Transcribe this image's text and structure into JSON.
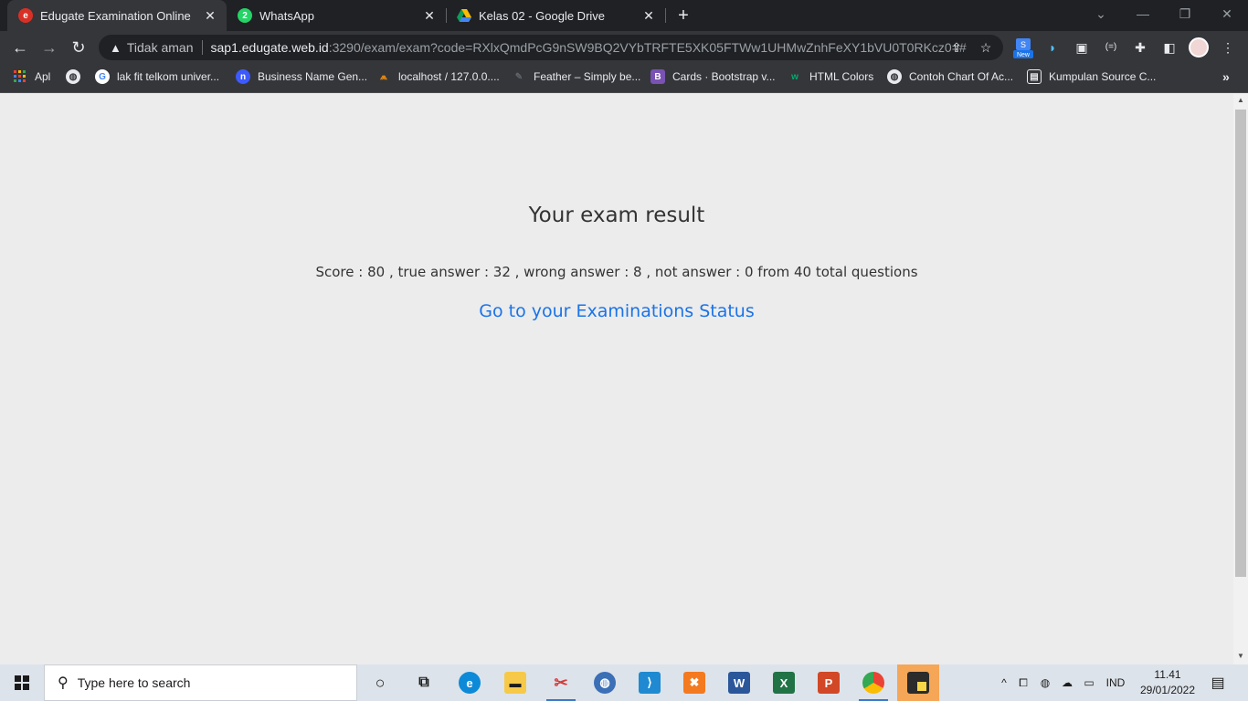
{
  "browser": {
    "tabs": [
      {
        "title": "Edugate Examination Online",
        "active": true,
        "icon": "edugate-icon"
      },
      {
        "title": "WhatsApp",
        "active": false,
        "icon": "whatsapp-icon"
      },
      {
        "title": "Kelas 02 - Google Drive",
        "active": false,
        "icon": "google-drive-icon"
      }
    ],
    "new_tab_glyph": "+",
    "window_controls": {
      "minimize": "—",
      "restore": "❐",
      "close": "✕"
    },
    "security_label": "Tidak aman",
    "url_host": "sap1.edugate.web.id",
    "url_rest": ":3290/exam/exam?code=RXlxQmdPcG9nSW9BQ2VYbTRFTE5XK05FTWw1UHMwZnhFeXY1bVU0T0RKcz0=#",
    "extension_badge": "New"
  },
  "bookmarks": [
    {
      "label": "Apl",
      "icon": "apps-grid-icon"
    },
    {
      "label": "",
      "icon": "globe-icon"
    },
    {
      "label": "lak fit telkom univer...",
      "icon": "google-icon"
    },
    {
      "label": "Business Name Gen...",
      "icon": "namelix-icon"
    },
    {
      "label": "localhost / 127.0.0....",
      "icon": "phpmyadmin-icon"
    },
    {
      "label": "Feather – Simply be...",
      "icon": "feather-icon"
    },
    {
      "label": "Cards · Bootstrap v...",
      "icon": "bootstrap-icon"
    },
    {
      "label": "HTML Colors",
      "icon": "w3schools-icon"
    },
    {
      "label": "Contoh Chart Of Ac...",
      "icon": "globe-icon"
    },
    {
      "label": "Kumpulan Source C...",
      "icon": "page-icon"
    }
  ],
  "bookmarks_overflow": "»",
  "page": {
    "heading": "Your exam result",
    "score_text": "Score : 80 , true answer : 32 , wrong answer : 8 , not answer : 0 from 40 total questions",
    "link_text": "Go to your Examinations Status"
  },
  "exam_result": {
    "score": 80,
    "true_answer": 32,
    "wrong_answer": 8,
    "not_answer": 0,
    "total_questions": 40
  },
  "taskbar": {
    "search_placeholder": "Type here to search",
    "language": "IND",
    "time": "11.41",
    "date": "29/01/2022"
  },
  "colors": {
    "link": "#1a73e8",
    "page_bg": "#ececec",
    "browser_dark": "#202124",
    "toolbar": "#35363a",
    "taskbar": "#dde3ea"
  }
}
